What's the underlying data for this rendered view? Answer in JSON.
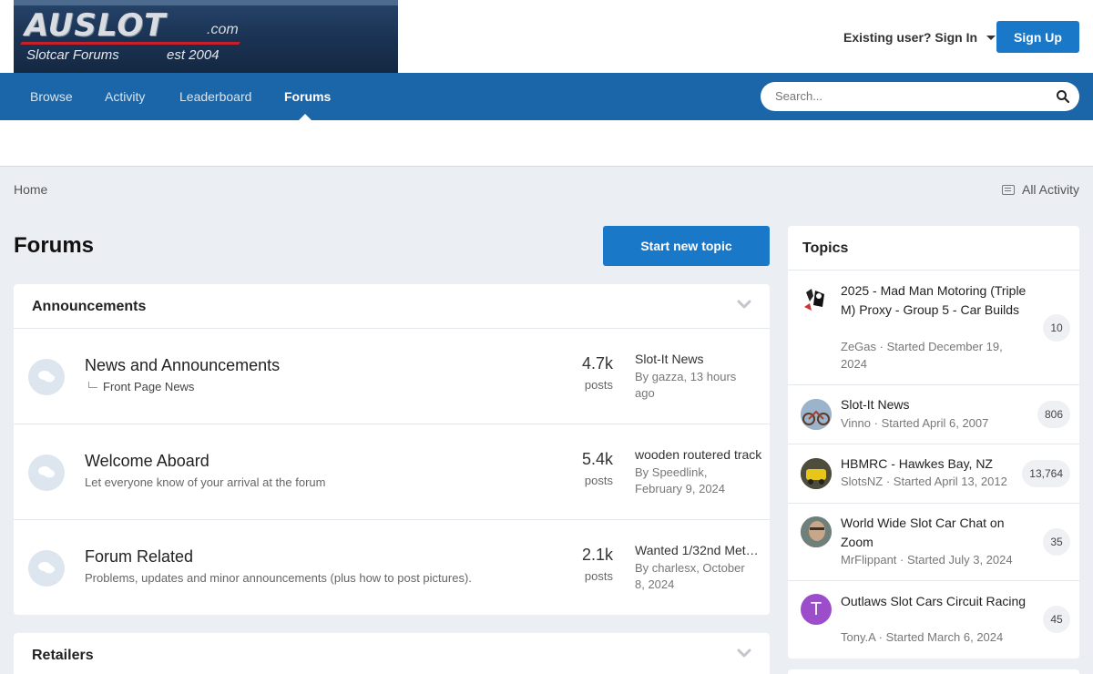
{
  "header": {
    "logo_text": "AUSLOT",
    "logo_dotcom": ".com",
    "logo_tagline": "Slotcar Forums",
    "logo_est": "est 2004",
    "signin_label": "Existing user? Sign In",
    "signup_label": "Sign Up"
  },
  "nav": {
    "items": [
      {
        "label": "Browse"
      },
      {
        "label": "Activity"
      },
      {
        "label": "Leaderboard"
      },
      {
        "label": "Forums"
      }
    ],
    "active": "Forums",
    "search_placeholder": "Search..."
  },
  "breadcrumb": {
    "home": "Home"
  },
  "all_activity": "All Activity",
  "page_title": "Forums",
  "start_topic": "Start new topic",
  "categories": [
    {
      "title": "Announcements",
      "forums": [
        {
          "name": "News and Announcements",
          "subforum": "Front Page News",
          "count": "4.7k",
          "posts_label": "posts",
          "last_title": "Slot-It News",
          "last_by": "By gazza, 13 hours ago"
        },
        {
          "name": "Welcome Aboard",
          "desc": "Let everyone know of your arrival at the forum",
          "count": "5.4k",
          "posts_label": "posts",
          "last_title": "wooden routered track",
          "last_by": "By Speedlink, February 9, 2024"
        },
        {
          "name": "Forum Related",
          "desc": "Problems, updates and minor announcements (plus how to post pictures).",
          "count": "2.1k",
          "posts_label": "posts",
          "last_title": "Wanted 1/32nd Metal...",
          "last_by": "By charlesx, October 8, 2024"
        }
      ]
    },
    {
      "title": "Retailers"
    }
  ],
  "sidebar": {
    "title": "Topics",
    "topics": [
      {
        "title": "2025 - Mad Man Motoring (Triple M) Proxy - Group 5 - Car Builds",
        "meta": "ZeGas · Started December 19, 2024",
        "count": "10"
      },
      {
        "title": "Slot-It News",
        "meta": "Vinno · Started April 6, 2007",
        "count": "806"
      },
      {
        "title": "HBMRC - Hawkes Bay, NZ",
        "meta": "SlotsNZ · Started April 13, 2012",
        "count": "13,764"
      },
      {
        "title": "World Wide Slot Car Chat on Zoom",
        "meta": "MrFlippant · Started July 3, 2024",
        "count": "35"
      },
      {
        "title": "Outlaws Slot Cars Circuit Racing",
        "meta": "Tony.A · Started March 6, 2024",
        "count": "45",
        "avatar_letter": "T"
      }
    ]
  },
  "colors": {
    "brand_blue": "#1a66a8",
    "button_blue": "#1a78c8",
    "avatar_purple": "#9b4dca"
  }
}
